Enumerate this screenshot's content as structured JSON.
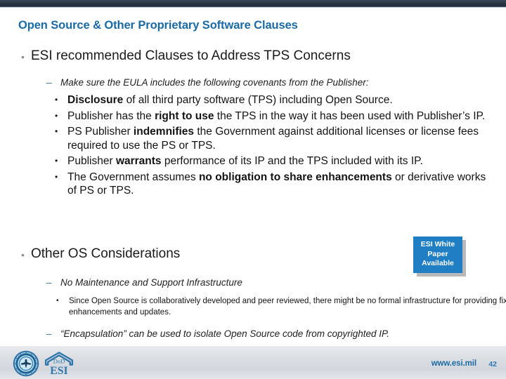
{
  "slide": {
    "title": "Open Source & Other Proprietary Software Clauses",
    "title_color": "#1a6aa5",
    "accent_color": "#1f7ec4",
    "topbar_color": "#2b3746"
  },
  "content": {
    "esi_recommended": {
      "marker": "•",
      "text": "ESI recommended Clauses to Address TPS Concerns"
    },
    "eula_lead": {
      "marker": "–",
      "text": "Make sure the EULA includes the following covenants from the Publisher:"
    },
    "clauses": [
      {
        "marker": "•",
        "bold": "Disclosure",
        "pre": "",
        "post": " of all third party software (TPS) including Open Source."
      },
      {
        "marker": "•",
        "pre": "Publisher has the ",
        "bold": "right to use",
        "post": " the TPS in the way it has been used with Publisher’s IP."
      },
      {
        "marker": "•",
        "pre": "PS Publisher ",
        "bold": "indemnifies",
        "post": " the Government against additional licenses  or license fees  required to use the PS or TPS."
      },
      {
        "marker": "•",
        "pre": "Publisher ",
        "bold": "warrants",
        "post": " performance of its IP and the TPS included with its IP."
      },
      {
        "marker": "•",
        "pre": "The Government assumes ",
        "bold": "no obligation to share enhancements",
        "post": " or derivative works of PS or TPS."
      }
    ],
    "other_os": {
      "marker": "•",
      "text": "Other OS Considerations"
    },
    "no_maintenance": {
      "marker": "–",
      "text": "No Maintenance and Support Infrastructure"
    },
    "since_open_source": {
      "marker": "•",
      "text": "Since Open Source is collaboratively developed and peer reviewed, there might be no formal infrastructure for providing fixes, patches, enhancements and updates."
    },
    "encapsulation": {
      "marker": "–",
      "text": "“Encapsulation” can be used to isolate Open Source code from copyrighted IP."
    }
  },
  "callout": {
    "line1": "ESI White",
    "line2": "Paper",
    "line3": "Available",
    "background": "#1f7ec4"
  },
  "footer": {
    "url": "www.esi.mil",
    "page_number": "42",
    "logo_dod_name": "dod-seal-logo",
    "logo_esi_name": "dod-esi-logo",
    "esi_logo_top_text": "DoD",
    "esi_logo_main_text": "ESI"
  }
}
